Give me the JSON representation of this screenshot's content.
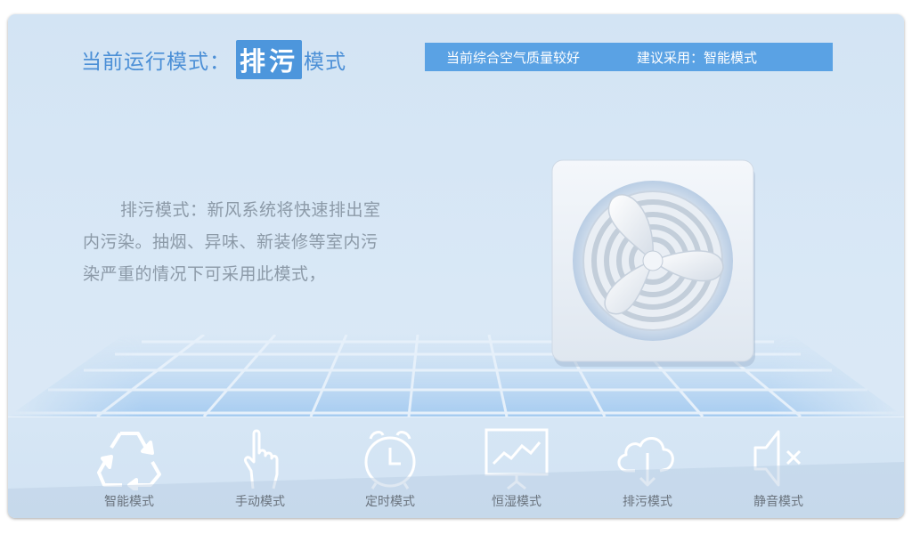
{
  "header": {
    "mode_prefix": "当前运行模式：",
    "mode_value": "排污",
    "mode_suffix": "模式"
  },
  "air_status": {
    "quality": "当前综合空气质量较好",
    "suggestion": "建议采用：智能模式"
  },
  "description": "排污模式：新风系统将快速排出室内污染。抽烟、异味、新装修等室内污染严重的情况下可采用此模式，",
  "modes": [
    {
      "label": "智能模式",
      "icon": "recycle-icon"
    },
    {
      "label": "手动模式",
      "icon": "hand-pointer-icon"
    },
    {
      "label": "定时模式",
      "icon": "alarm-clock-icon"
    },
    {
      "label": "恒湿模式",
      "icon": "chart-board-icon"
    },
    {
      "label": "排污模式",
      "icon": "cloud-download-icon"
    },
    {
      "label": "静音模式",
      "icon": "mute-speaker-icon"
    }
  ],
  "colors": {
    "accent": "#4d96dc",
    "status_bar": "#5aa2e4",
    "background": "#d6e6f5"
  }
}
